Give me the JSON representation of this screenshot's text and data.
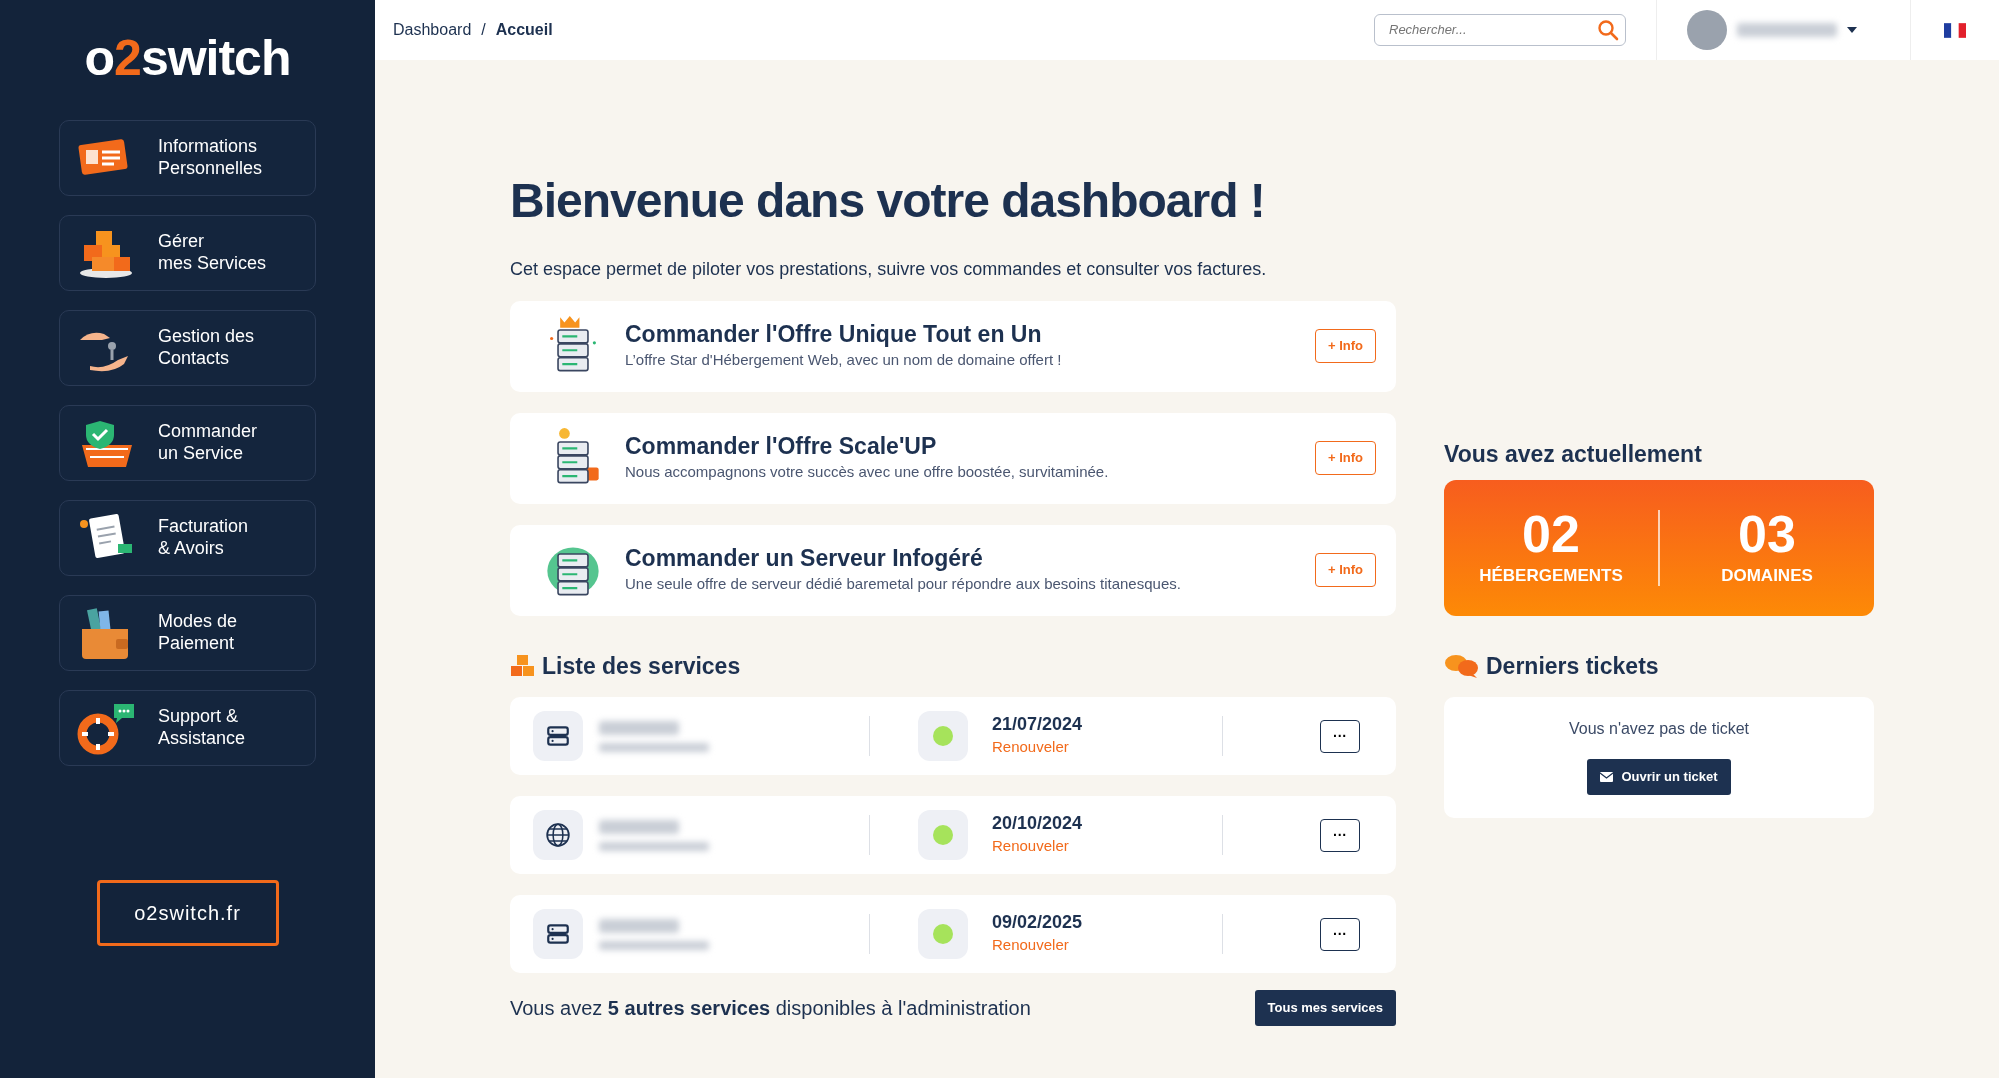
{
  "logo": {
    "prefix": "o",
    "accent": "2",
    "suffix": "switch"
  },
  "sidebar": {
    "items": [
      {
        "kind": "id-card",
        "label": "Informations\nPersonnelles"
      },
      {
        "kind": "boxes",
        "label": "Gérer\nmes Services"
      },
      {
        "kind": "keys",
        "label": "Gestion des\nContacts"
      },
      {
        "kind": "basket",
        "label": "Commander\nun Service"
      },
      {
        "kind": "invoice",
        "label": "Facturation\n& Avoirs"
      },
      {
        "kind": "wallet",
        "label": "Modes de\nPaiement"
      },
      {
        "kind": "lifebuoy",
        "label": "Support &\nAssistance"
      }
    ],
    "site_button": "o2switch.fr"
  },
  "breadcrumb": {
    "separator": "/",
    "items": [
      {
        "label": "Dashboard",
        "selected": false
      },
      {
        "label": "Accueil",
        "selected": true
      }
    ]
  },
  "search": {
    "placeholder": "Rechercher..."
  },
  "intro": {
    "title": "Bienvenue dans votre dashboard !",
    "text": "Cet espace permet de piloter vos prestations, suivre vos commandes et consulter vos factures."
  },
  "offers": [
    {
      "kind": "crown",
      "title": "Commander l'Offre Unique Tout en Un",
      "text": "L’offre Star d'Hébergement Web, avec un nom de domaine offert !",
      "button": "+ Info"
    },
    {
      "kind": "briefcase",
      "title": "Commander l'Offre Scale'UP",
      "text": "Nous accompagnons votre succès avec une offre boostée, survitaminée.",
      "button": "+ Info"
    },
    {
      "kind": "cloud",
      "title": "Commander un Serveur Infogéré",
      "text": "Une seule offre de serveur dédié baremetal pour répondre aux besoins titanesques.",
      "button": "+ Info"
    }
  ],
  "stats": {
    "title": "Vous avez actuellement",
    "items": [
      {
        "count": "02",
        "label": "HÉBERGEMENTS"
      },
      {
        "count": "03",
        "label": "DOMAINES"
      }
    ]
  },
  "services": {
    "title": "Liste des services",
    "rows": [
      {
        "kind": "server",
        "color": "#a6e35b",
        "date": "21/07/2024",
        "action": "Renouveler",
        "menu": "···"
      },
      {
        "kind": "globe",
        "color": "#a6e35b",
        "date": "20/10/2024",
        "action": "Renouveler",
        "menu": "···"
      },
      {
        "kind": "server",
        "color": "#a6e35b",
        "date": "09/02/2025",
        "action": "Renouveler",
        "menu": "···"
      }
    ],
    "footer": "Vous avez **5 autres services** disponibles à l'administration",
    "button": "Tous mes services"
  },
  "tickets": {
    "title": "Derniers tickets",
    "empty": "Vous n'avez pas de ticket",
    "button": "Ouvrir un ticket"
  }
}
